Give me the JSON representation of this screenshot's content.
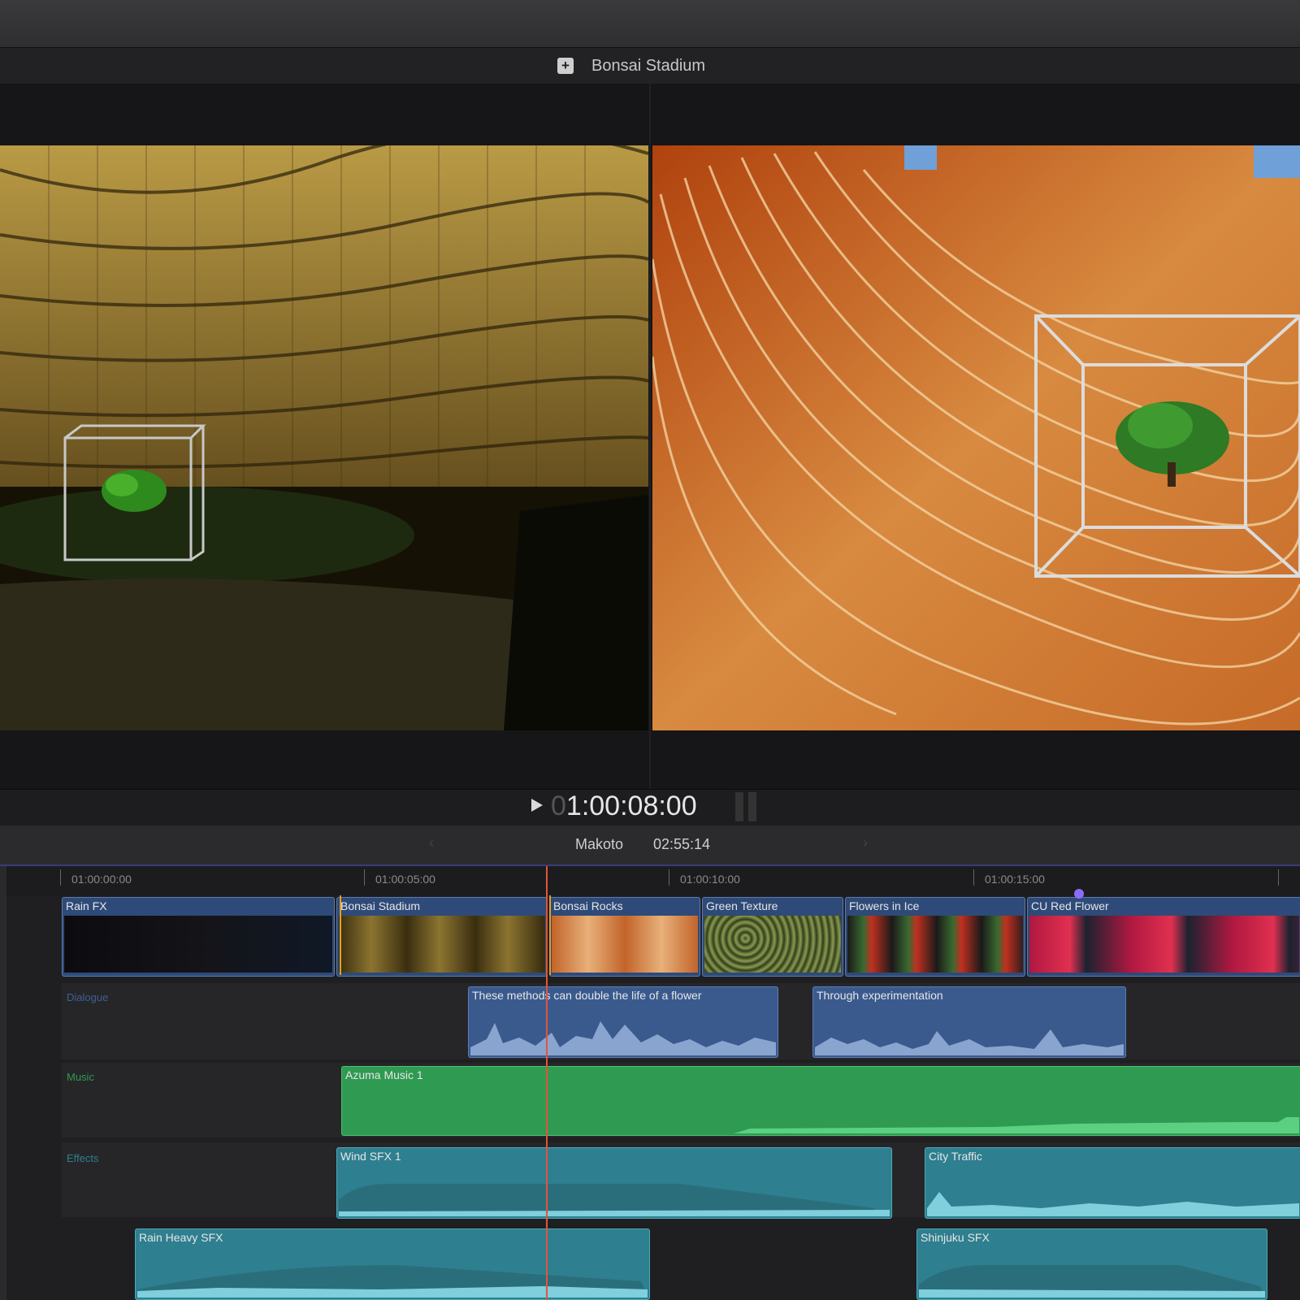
{
  "window": {
    "title": "Bonsai Stadium"
  },
  "viewer": {
    "timecode_prefix": "0",
    "timecode": "1:00:08:00"
  },
  "timeline": {
    "project_name": "Makoto",
    "project_duration": "02:55:14",
    "nav_back": "‹",
    "nav_forward": "›",
    "ruler": [
      "01:00:00:00",
      "01:00:05:00",
      "01:00:10:00",
      "01:00:15:00"
    ],
    "lanes": {
      "dialogue": "Dialogue",
      "music": "Music",
      "effects": "Effects"
    },
    "video_clips": [
      "Rain FX",
      "Bonsai Stadium",
      "Bonsai Rocks",
      "Green Texture",
      "Flowers in Ice",
      "CU Red Flower"
    ],
    "dialogue_clips": [
      "These methods can double the life of a flower",
      "Through experimentation"
    ],
    "music_clips": [
      "Azuma Music 1"
    ],
    "effects_clips": [
      "Wind SFX 1",
      "City Traffic",
      "Rain Heavy SFX",
      "Shinjuku SFX"
    ]
  },
  "colors": {
    "accent_playhead": "#e0553a",
    "music_lane": "#2f9a52",
    "dialogue_lane": "#3a5a8e",
    "effects_lane": "#2e7f8f",
    "selection": "#e6a11a"
  }
}
